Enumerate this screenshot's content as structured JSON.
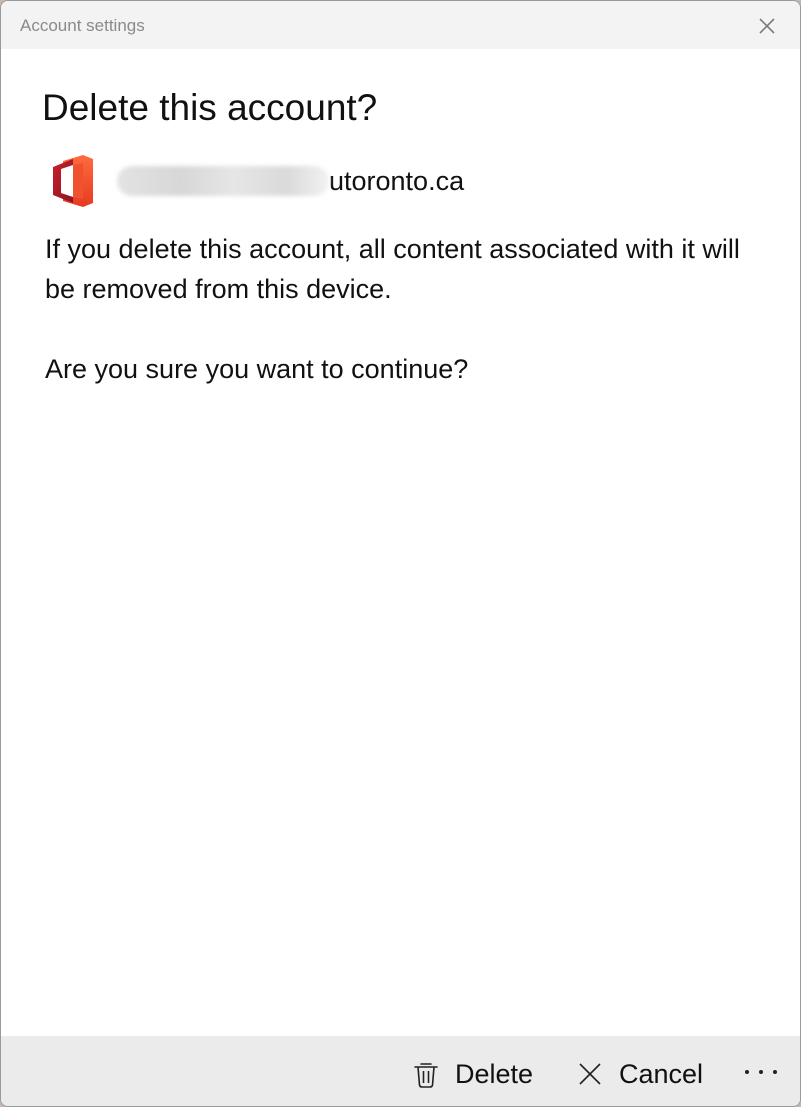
{
  "window": {
    "title": "Account settings"
  },
  "dialog": {
    "heading": "Delete this account?",
    "account": {
      "icon": "office-icon",
      "email_visible_part": "utoronto.ca"
    },
    "message": "If you delete this account, all content associated with it will be removed from this device.",
    "question": "Are you sure you want to continue?"
  },
  "footer": {
    "delete_label": "Delete",
    "cancel_label": "Cancel",
    "more_label": "···"
  },
  "colors": {
    "titlebar_bg": "#f3f3f3",
    "content_bg": "#ffffff",
    "footer_bg": "#ebebeb",
    "text": "#111111",
    "title_text": "#8a8a8a"
  }
}
